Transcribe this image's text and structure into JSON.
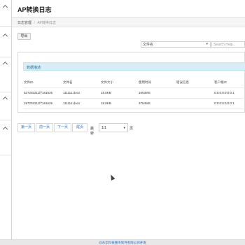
{
  "page": {
    "title": "AP转换日志"
  },
  "breadcrumb": {
    "root": "日志管理",
    "separator": "/",
    "current": "AP转换日志"
  },
  "toolbar": {
    "export_label": "导出",
    "filter_value": "文件名",
    "search_placeholder": "Search Help..."
  },
  "alert": {
    "text": "数据描述:"
  },
  "table": {
    "columns": [
      "文件ID",
      "文件名",
      "文件大小",
      "使用时间",
      "错误信息",
      "客户端IP"
    ],
    "rows": [
      [
        "527202211f7161625",
        "111111.docx",
        "18.0KB",
        "1603MS",
        "",
        "0:0:0:0:0:0:0:1"
      ],
      [
        "197202211f7161625",
        "111111.docx",
        "18.0KB",
        "3754MS",
        "",
        "0:0:0:0:0:0:0:1"
      ]
    ]
  },
  "pagination": {
    "first": "第一页",
    "prev": "前一页",
    "next": "下一页",
    "last": "尾页",
    "goto_label": "跳转",
    "page_select_value": "1/1",
    "page_suffix": "页"
  },
  "footer": {
    "text": "@东华科技重庆软件有限公司开发"
  },
  "colors": {
    "accent": "#2a6fbd",
    "alert_bg": "#d9edf7",
    "alert_text": "#31708f"
  },
  "icons": {
    "sidebar_chevron": "chevron-up-icon",
    "cursor": "mouse-cursor-icon"
  }
}
